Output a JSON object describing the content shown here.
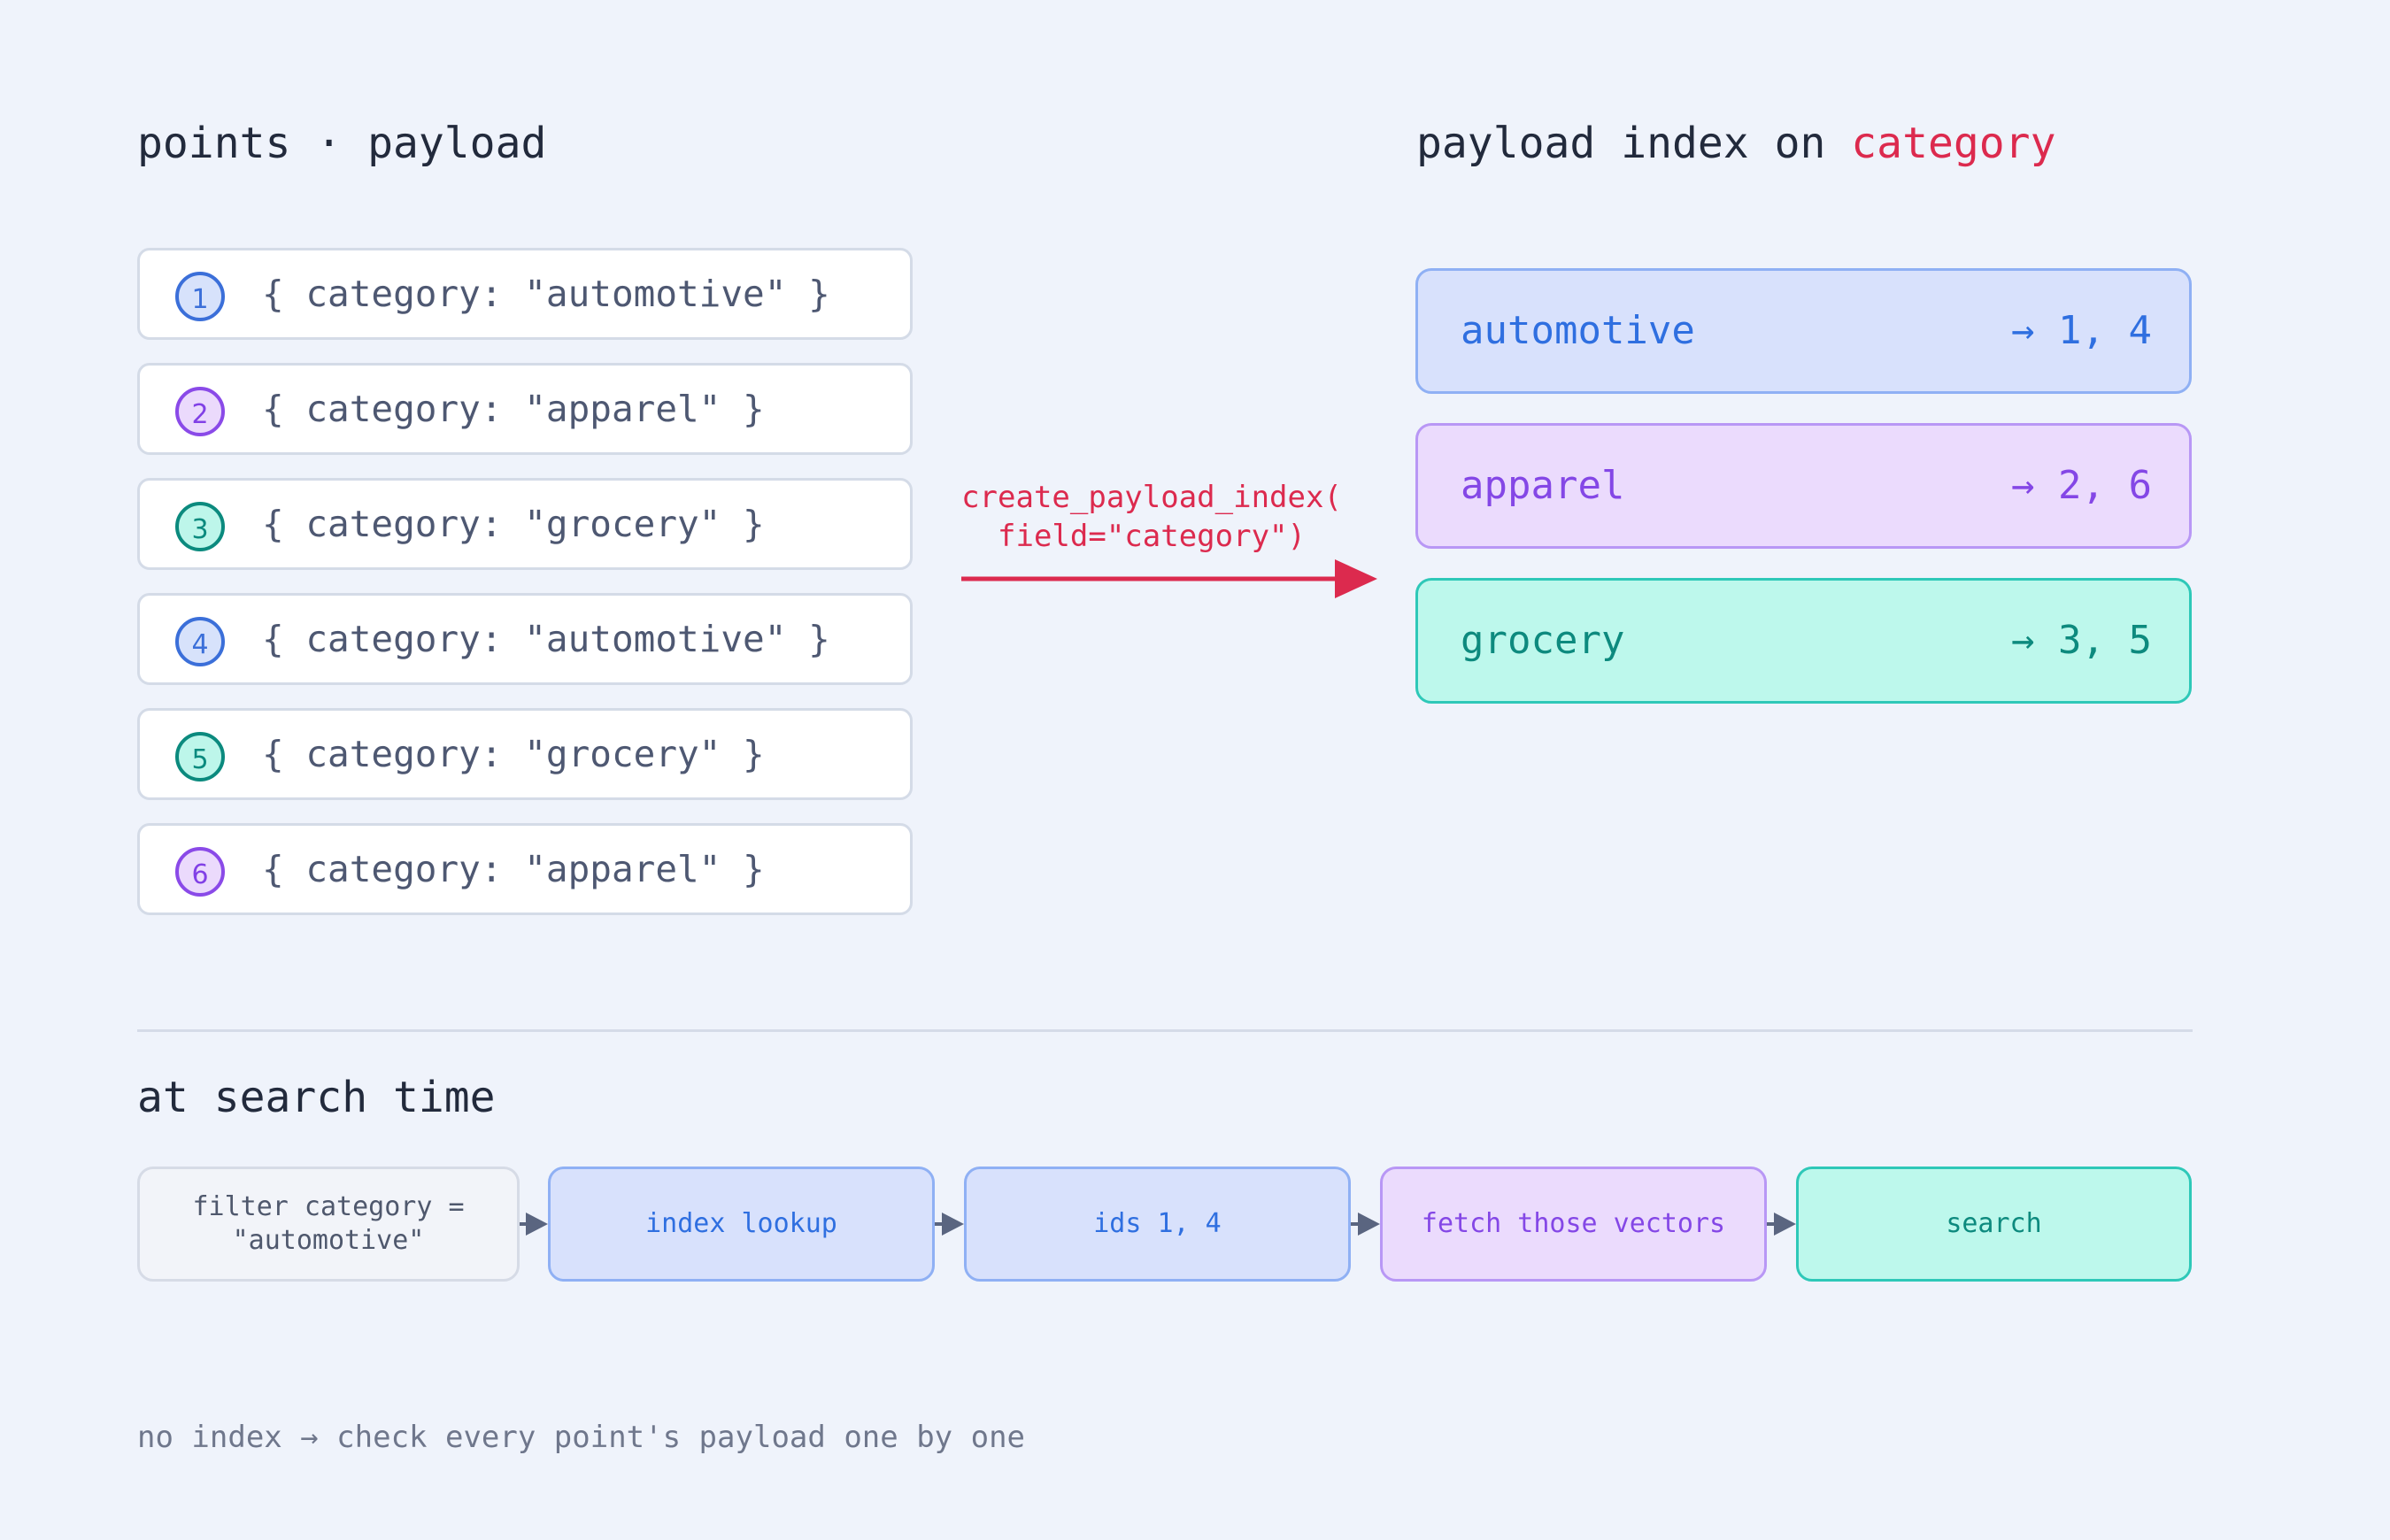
{
  "left_title": "points · payload",
  "right_title": {
    "prefix": "payload index on ",
    "field": "category"
  },
  "points": [
    {
      "id": "1",
      "code": "{ category: \"automotive\" }",
      "tone": "blue"
    },
    {
      "id": "2",
      "code": "{ category: \"apparel\" }",
      "tone": "purple"
    },
    {
      "id": "3",
      "code": "{ category: \"grocery\" }",
      "tone": "teal"
    },
    {
      "id": "4",
      "code": "{ category: \"automotive\" }",
      "tone": "blue"
    },
    {
      "id": "5",
      "code": "{ category: \"grocery\" }",
      "tone": "teal"
    },
    {
      "id": "6",
      "code": "{ category: \"apparel\" }",
      "tone": "purple"
    }
  ],
  "arrow_label": {
    "line1": "create_payload_index(",
    "line2": "field=\"category\")"
  },
  "index_buckets": [
    {
      "name": "automotive",
      "ids": "→ 1, 4",
      "tone": "blue"
    },
    {
      "name": "apparel",
      "ids": "→ 2, 6",
      "tone": "purple"
    },
    {
      "name": "grocery",
      "ids": "→ 3, 5",
      "tone": "teal"
    }
  ],
  "search_title": "at search time",
  "steps": [
    {
      "line1": "filter category =",
      "line2": "\"automotive\"",
      "tone": "gray"
    },
    {
      "line1": "index lookup",
      "tone": "blue"
    },
    {
      "line1": "ids 1, 4",
      "tone": "blue"
    },
    {
      "line1": "fetch those vectors",
      "tone": "purple"
    },
    {
      "line1": "search",
      "tone": "teal"
    }
  ],
  "footnote": "no index → check every point's payload one by one",
  "colors": {
    "background": "#eff3fb",
    "accent": "#dc2a4e",
    "blue": "#3b6fd9",
    "purple": "#8447e6",
    "teal": "#0d8a7e",
    "connector": "#5a6580"
  }
}
